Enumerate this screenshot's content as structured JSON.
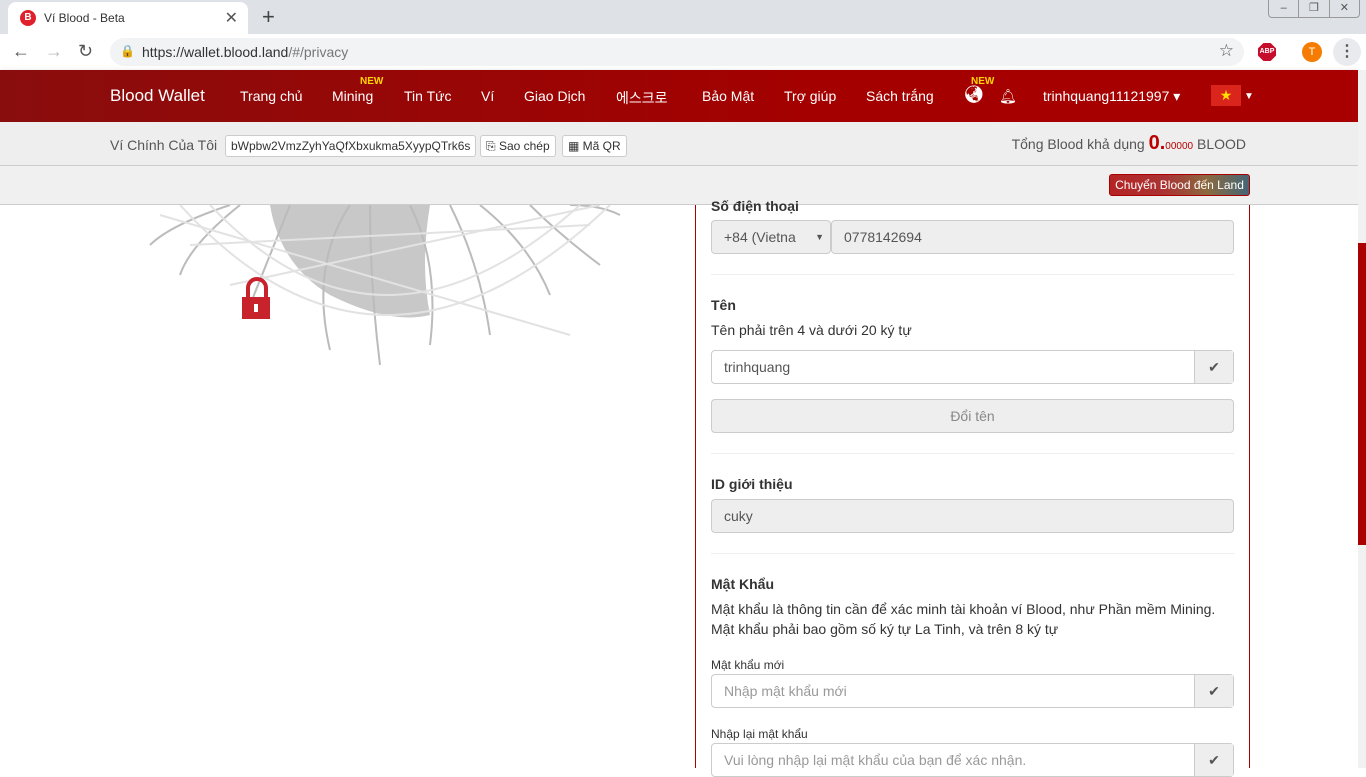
{
  "browser": {
    "tab_title": "Ví Blood - Beta",
    "url_host": "https://wallet.blood.land",
    "url_path": "/#/privacy",
    "avatar_letter": "T",
    "abp_label": "ABP"
  },
  "nav": {
    "brand": "Blood Wallet",
    "items": [
      "Trang chủ",
      "Mining",
      "Tin Tức",
      "Ví",
      "Giao Dịch",
      "에스크로",
      "Bảo Mật",
      "Trợ giúp",
      "Sách trắng"
    ],
    "new_badge": "NEW",
    "username": "trinhquang11121997"
  },
  "wallet": {
    "label": "Ví Chính Của Tôi",
    "address": "bWpbw2VmzZyhYaQfXbxukma5XyypQTrk6s",
    "copy": "Sao chép",
    "qr": "Mã QR",
    "balance_label": "Tổng Blood khả dụng",
    "balance_int": "0.",
    "balance_dec": "00000",
    "unit": "BLOOD",
    "transfer": "Chuyển Blood đến Land"
  },
  "form": {
    "phone_label": "Số điện thoại",
    "country": "+84 (Vietna",
    "phone": "0778142694",
    "name_title": "Tên",
    "name_hint": "Tên phải trên 4 và dưới 20 ký tự",
    "name_value": "trinhquang",
    "rename": "Đổi tên",
    "ref_title": "ID giới thiệu",
    "ref_value": "cuky",
    "pw_title": "Mật Khẩu",
    "pw_desc1": "Mật khẩu là thông tin cần để xác minh tài khoản ví Blood, như Phần mềm Mining.",
    "pw_desc2": "Mật khẩu phải bao gồm số ký tự La Tinh, và trên 8 ký tự",
    "new_pw_label": "Mật khẩu mới",
    "new_pw_placeholder": "Nhập mật khẩu mới",
    "confirm_label": "Nhập lại mật khẩu",
    "confirm_placeholder": "Vui lòng nhập lại mật khẩu của bạn để xác nhận."
  }
}
